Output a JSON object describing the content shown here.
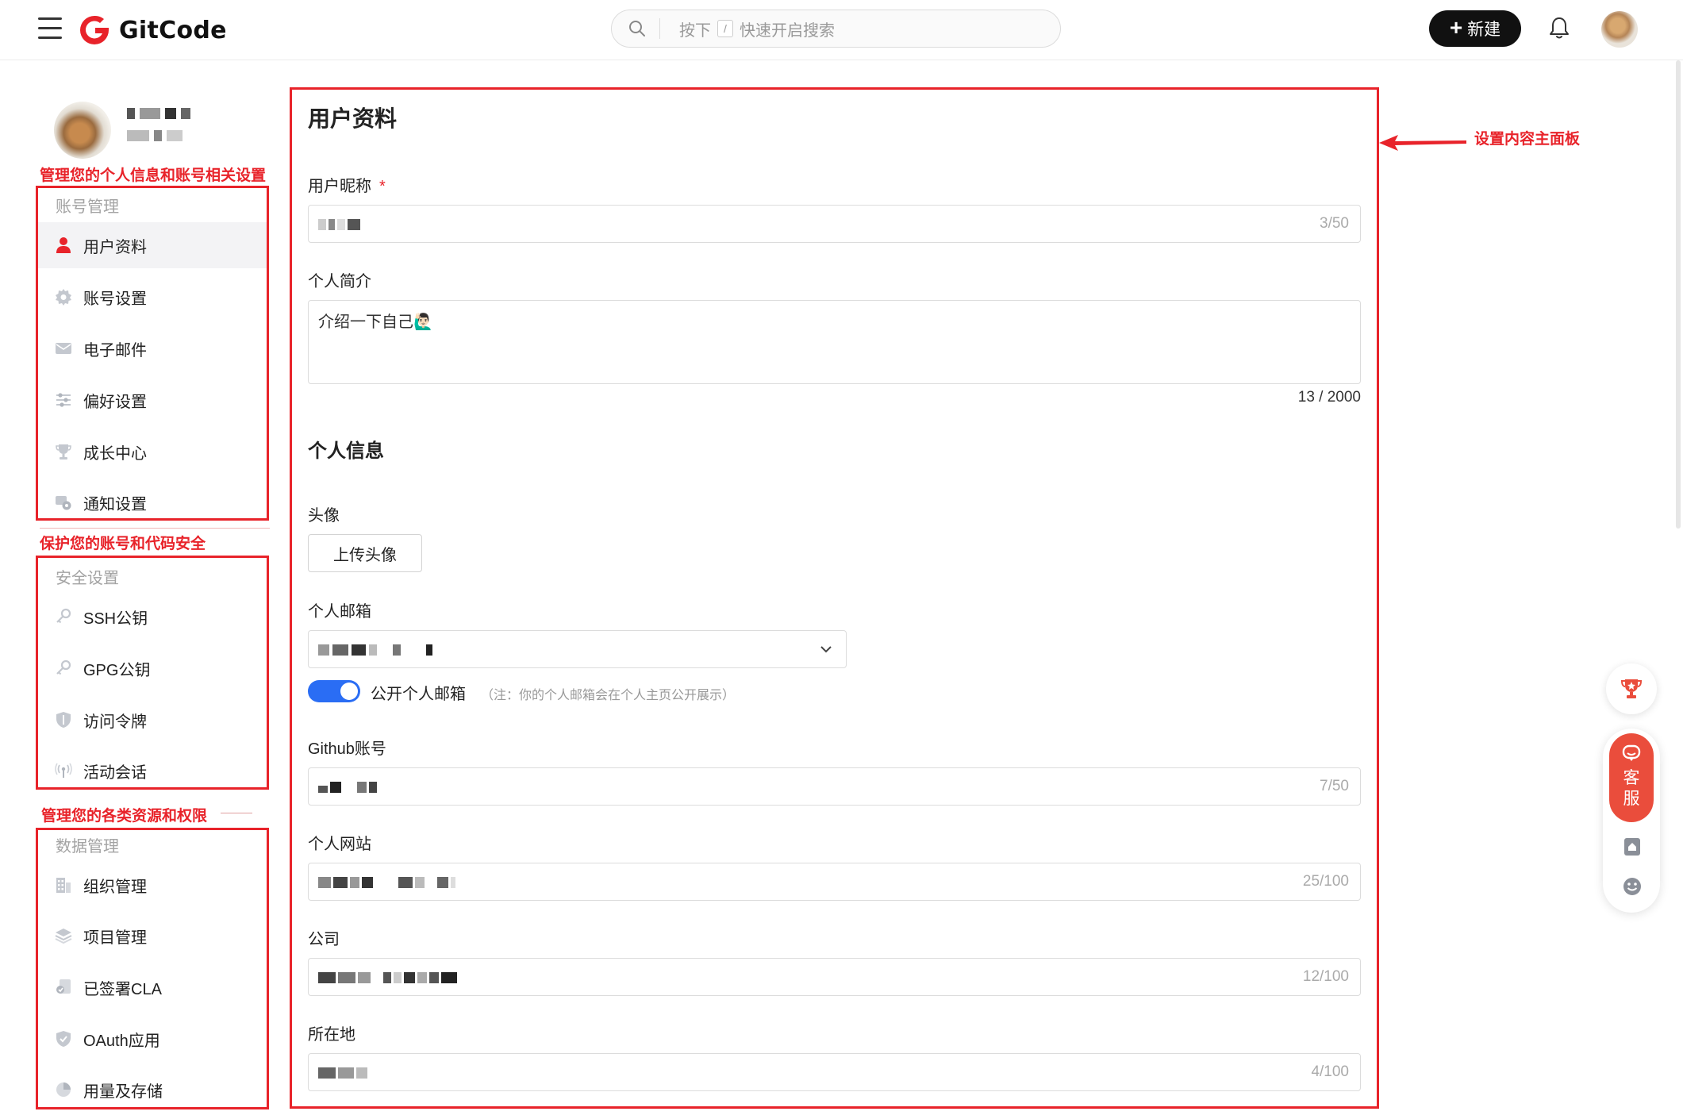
{
  "header": {
    "logo_text": "GitCode",
    "search_prefix": "按下",
    "search_key": "/",
    "search_placeholder": "快速开启搜索",
    "new_button_label": "新建"
  },
  "annotations": {
    "account_group": "管理您的个人信息和账号相关设置",
    "security_group": "保护您的账号和代码安全",
    "data_group": "管理您的各类资源和权限",
    "main_panel": "设置内容主面板"
  },
  "sidebar": {
    "groups": [
      {
        "title": "账号管理",
        "items": [
          {
            "label": "用户资料",
            "icon": "user-icon",
            "active": true
          },
          {
            "label": "账号设置",
            "icon": "gear-icon"
          },
          {
            "label": "电子邮件",
            "icon": "mail-icon"
          },
          {
            "label": "偏好设置",
            "icon": "sliders-icon"
          },
          {
            "label": "成长中心",
            "icon": "trophy-icon"
          },
          {
            "label": "通知设置",
            "icon": "notification-gear-icon"
          }
        ]
      },
      {
        "title": "安全设置",
        "items": [
          {
            "label": "SSH公钥",
            "icon": "key-icon"
          },
          {
            "label": "GPG公钥",
            "icon": "key-icon"
          },
          {
            "label": "访问令牌",
            "icon": "shield-icon"
          },
          {
            "label": "活动会话",
            "icon": "broadcast-icon"
          }
        ]
      },
      {
        "title": "数据管理",
        "items": [
          {
            "label": "组织管理",
            "icon": "building-icon"
          },
          {
            "label": "项目管理",
            "icon": "layers-icon"
          },
          {
            "label": "已签署CLA",
            "icon": "document-sign-icon"
          },
          {
            "label": "OAuth应用",
            "icon": "shield-check-icon"
          },
          {
            "label": "用量及存储",
            "icon": "pie-chart-icon"
          }
        ]
      }
    ]
  },
  "main": {
    "title": "用户资料",
    "nickname": {
      "label": "用户昵称",
      "required_mark": "*",
      "counter": "3/50"
    },
    "bio": {
      "label": "个人简介",
      "value": "介绍一下自己",
      "emoji": "🙋🏻‍♂️",
      "counter": "13 / 2000"
    },
    "personal_info_title": "个人信息",
    "avatar": {
      "label": "头像",
      "upload_label": "上传头像"
    },
    "email": {
      "label": "个人邮箱",
      "public_toggle_label": "公开个人邮箱",
      "public_toggle_on": true,
      "note": "（注：你的个人邮箱会在个人主页公开展示）"
    },
    "github": {
      "label": "Github账号",
      "counter": "7/50"
    },
    "website": {
      "label": "个人网站",
      "counter": "25/100"
    },
    "company": {
      "label": "公司",
      "counter": "12/100"
    },
    "location": {
      "label": "所在地",
      "counter": "4/100"
    }
  },
  "floating_widget": {
    "service_label_line1": "客",
    "service_label_line2": "服"
  },
  "colors": {
    "brand_red": "#e8232a",
    "toggle_blue": "#2a6df4",
    "service_orange": "#ea4d3c"
  }
}
